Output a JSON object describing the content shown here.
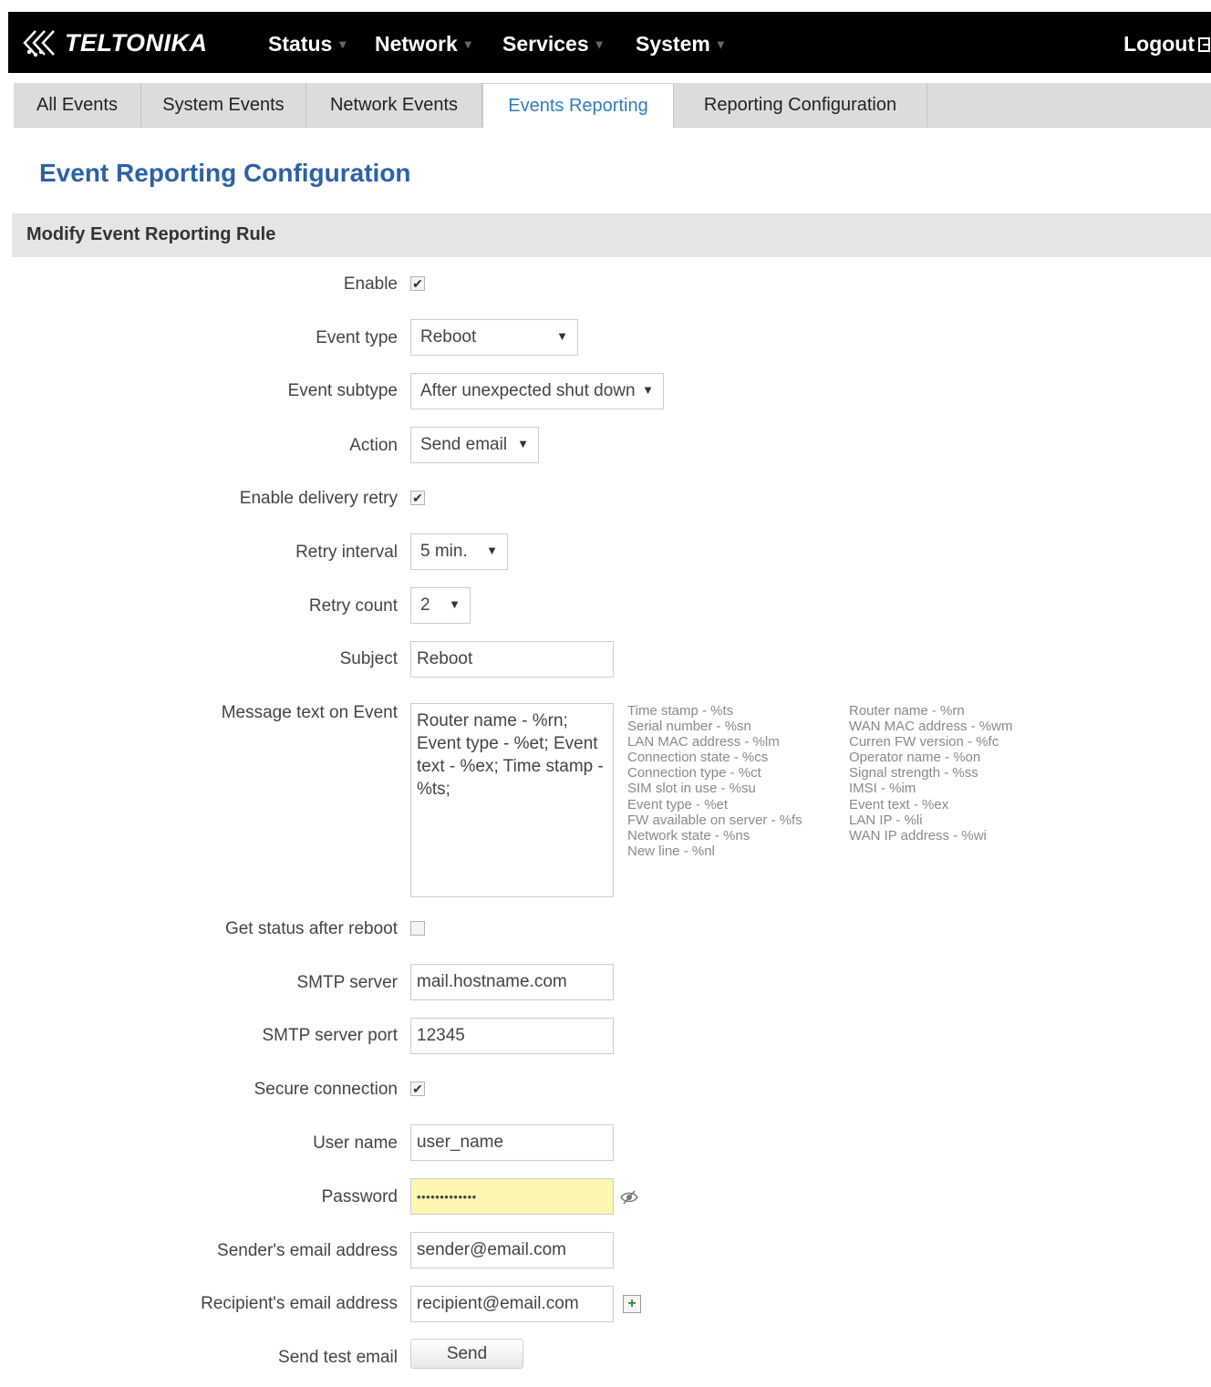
{
  "header": {
    "logo_text": "TELTONIKA",
    "nav": [
      {
        "label": "Status"
      },
      {
        "label": "Network"
      },
      {
        "label": "Services"
      },
      {
        "label": "System"
      }
    ],
    "logout_label": "Logout"
  },
  "tabs": [
    {
      "label": "All Events",
      "active": false
    },
    {
      "label": "System Events",
      "active": false
    },
    {
      "label": "Network Events",
      "active": false
    },
    {
      "label": "Events Reporting",
      "active": true
    },
    {
      "label": "Reporting Configuration",
      "active": false
    }
  ],
  "page_title": "Event Reporting Configuration",
  "section_title": "Modify Event Reporting Rule",
  "form": {
    "enable": {
      "label": "Enable",
      "checked": true
    },
    "event_type": {
      "label": "Event type",
      "value": "Reboot"
    },
    "event_subtype": {
      "label": "Event subtype",
      "value": "After unexpected shut down"
    },
    "action": {
      "label": "Action",
      "value": "Send email"
    },
    "delivery_retry": {
      "label": "Enable delivery retry",
      "checked": true
    },
    "retry_interval": {
      "label": "Retry interval",
      "value": "5 min."
    },
    "retry_count": {
      "label": "Retry count",
      "value": "2"
    },
    "subject": {
      "label": "Subject",
      "value": "Reboot"
    },
    "message": {
      "label": "Message text on Event",
      "value": "Router name - %rn;\nEvent type - %et; Event\ntext - %ex; Time stamp -\n%ts;"
    },
    "variables_left": [
      "Time stamp - %ts",
      "Serial number - %sn",
      "LAN MAC address - %lm",
      "Connection state - %cs",
      "Connection type - %ct",
      "SIM slot in use - %su",
      "Event type - %et",
      "FW available on server - %fs",
      "Network state - %ns",
      "New line - %nl"
    ],
    "variables_right": [
      "Router name - %rn",
      "WAN MAC address - %wm",
      "Curren FW version - %fc",
      "Operator name - %on",
      "Signal strength - %ss",
      "IMSI - %im",
      "Event text - %ex",
      "LAN IP - %li",
      "WAN IP address - %wi"
    ],
    "status_after_reboot": {
      "label": "Get status after reboot",
      "checked": false
    },
    "smtp_server": {
      "label": "SMTP server",
      "value": "mail.hostname.com"
    },
    "smtp_port": {
      "label": "SMTP server port",
      "value": "12345"
    },
    "secure_connection": {
      "label": "Secure connection",
      "checked": true
    },
    "user_name": {
      "label": "User name",
      "value": "user_name"
    },
    "password": {
      "label": "Password",
      "value": "•••••••••••••"
    },
    "sender": {
      "label": "Sender's email address",
      "value": "sender@email.com"
    },
    "recipient": {
      "label": "Recipient's email address",
      "value": "recipient@email.com"
    },
    "send_test": {
      "label": "Send test email",
      "button_label": "Send"
    }
  },
  "colors": {
    "brand_blue": "#2c62a5",
    "active_tab": "#2f7ec0",
    "password_highlight": "#fbf7b0"
  },
  "icons": {
    "logo": "teltonika-logo-icon",
    "logout": "logout-icon",
    "checkmark": "checkmark-icon",
    "dropdown": "dropdown-arrow-icon",
    "show_password": "eye-icon",
    "add_recipient": "add-icon"
  }
}
